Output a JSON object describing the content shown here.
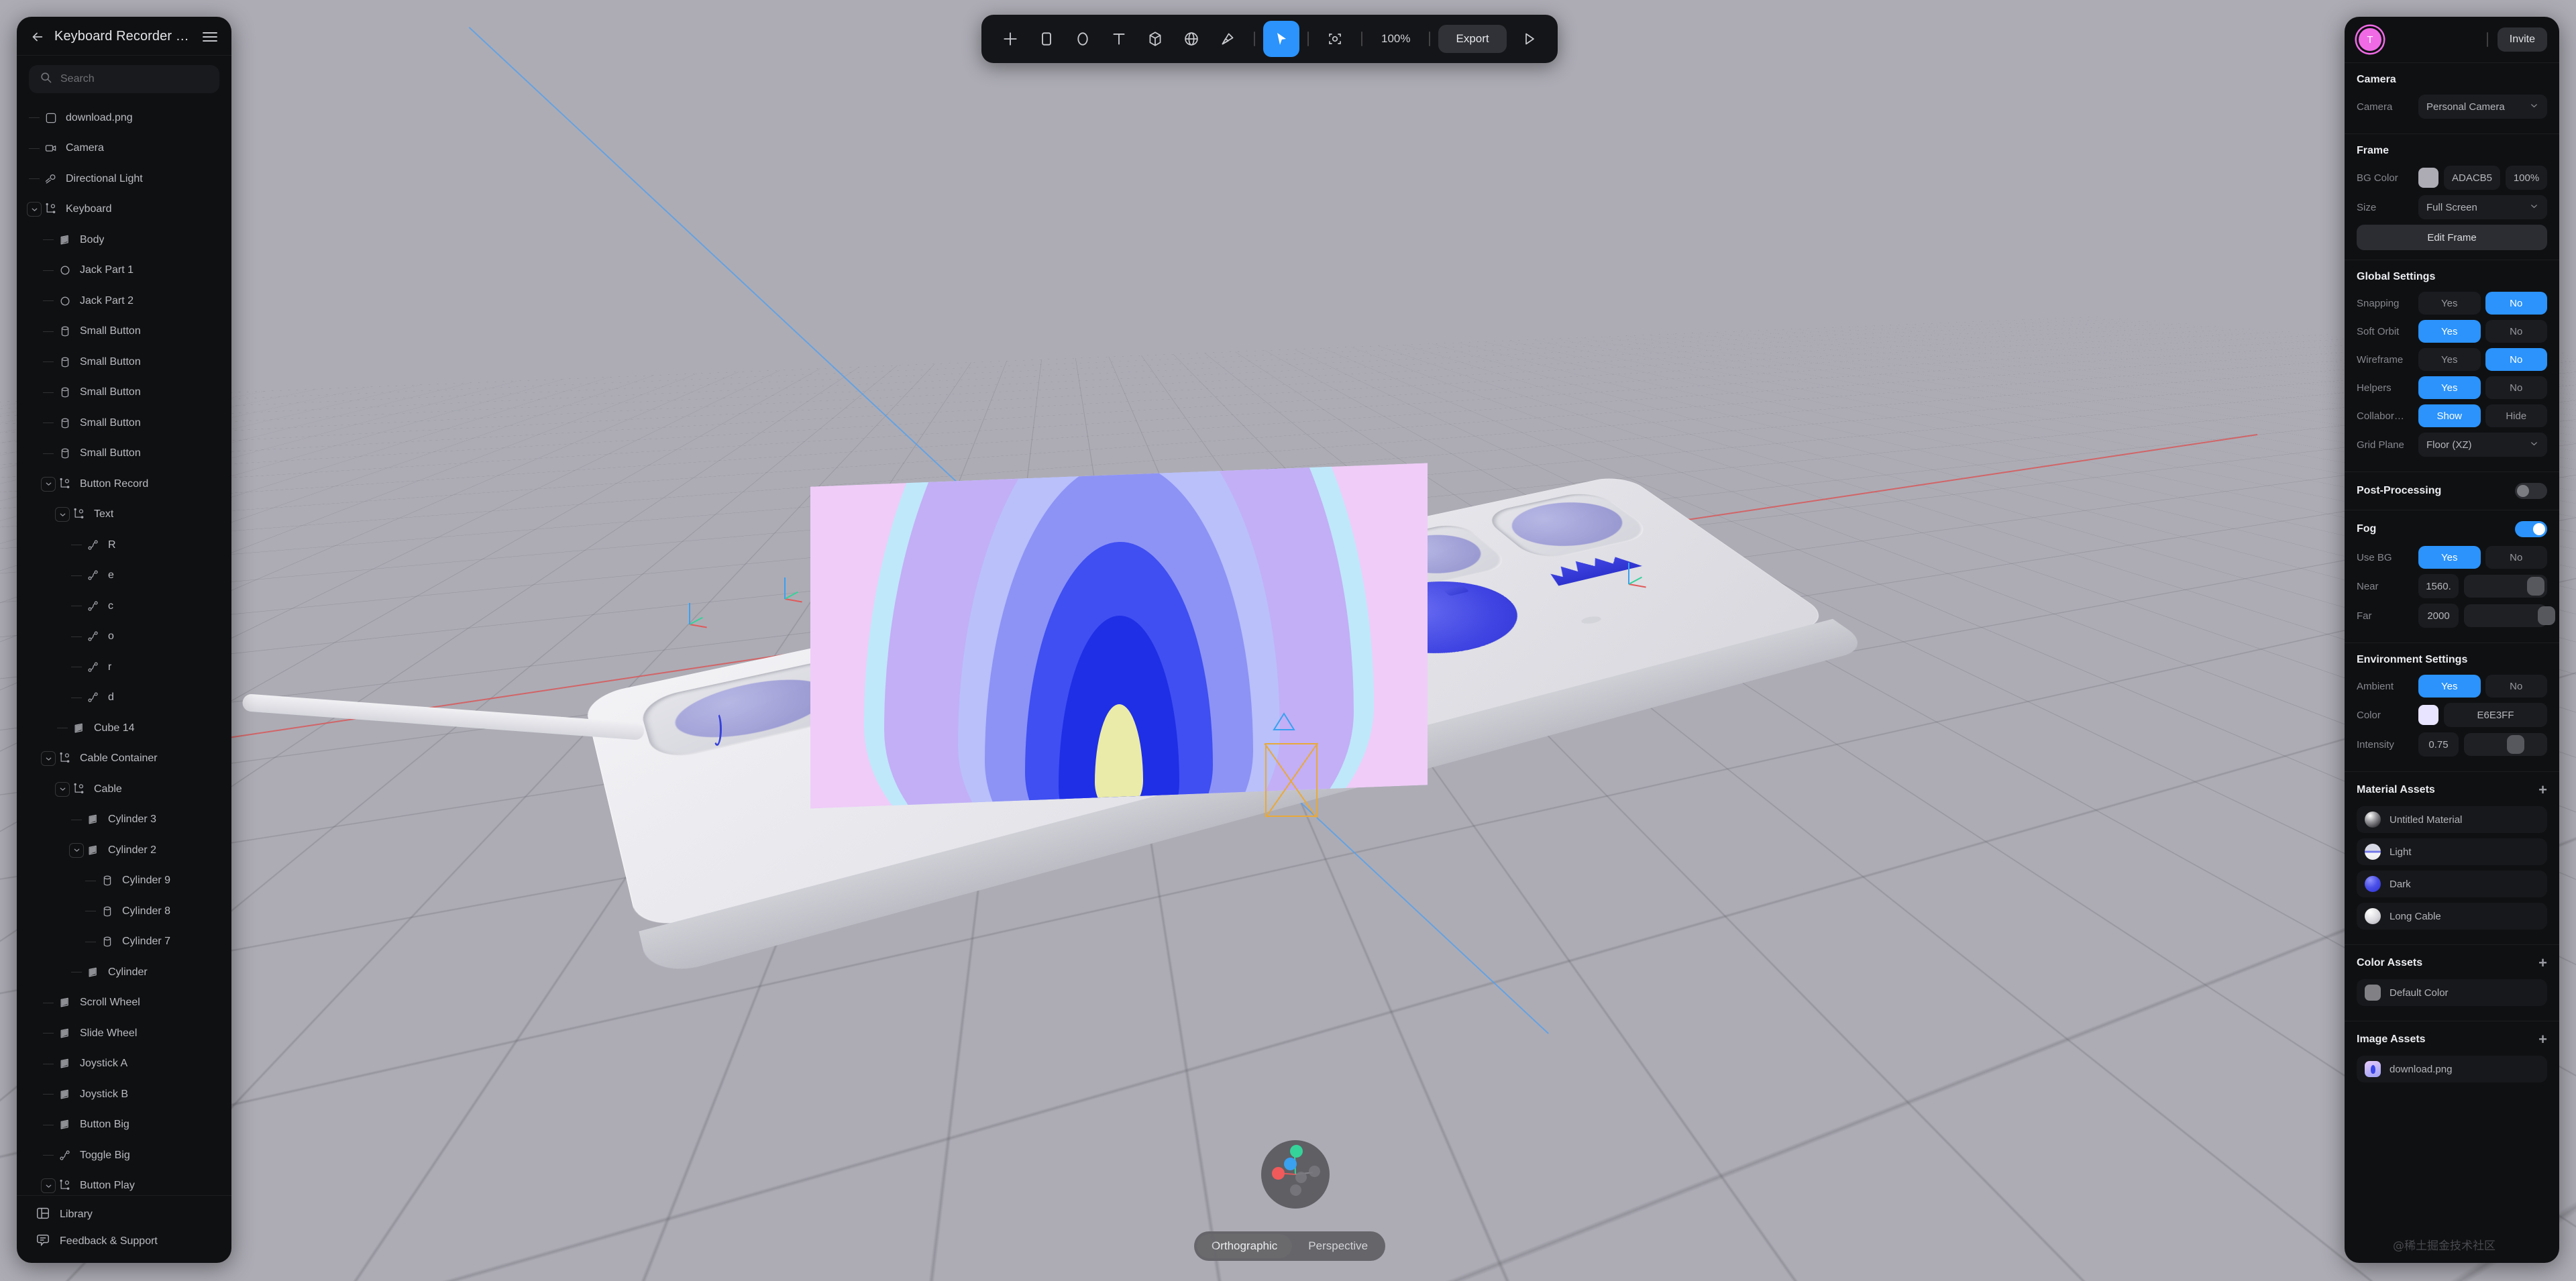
{
  "app": {
    "project_title": "Keyboard Recorder - Copy",
    "back_icon": "arrow-left-icon",
    "menu_icon": "hamburger-menu-icon"
  },
  "search": {
    "placeholder": "Search",
    "value": "",
    "icon": "search-icon"
  },
  "tree": {
    "items": [
      {
        "label": "download.png",
        "depth": 0,
        "icon": "image-icon",
        "expander": "none"
      },
      {
        "label": "Camera",
        "depth": 0,
        "icon": "camera-icon",
        "expander": "none"
      },
      {
        "label": "Directional Light",
        "depth": 0,
        "icon": "light-icon",
        "expander": "none"
      },
      {
        "label": "Keyboard",
        "depth": 0,
        "icon": "group-icon",
        "expander": "open"
      },
      {
        "label": "Body",
        "depth": 1,
        "icon": "mesh-icon",
        "expander": "none"
      },
      {
        "label": "Jack Part 1",
        "depth": 1,
        "icon": "circle-icon",
        "expander": "none"
      },
      {
        "label": "Jack Part 2",
        "depth": 1,
        "icon": "circle-icon",
        "expander": "none"
      },
      {
        "label": "Small Button",
        "depth": 1,
        "icon": "cylinder-icon",
        "expander": "none"
      },
      {
        "label": "Small Button",
        "depth": 1,
        "icon": "cylinder-icon",
        "expander": "none"
      },
      {
        "label": "Small Button",
        "depth": 1,
        "icon": "cylinder-icon",
        "expander": "none"
      },
      {
        "label": "Small Button",
        "depth": 1,
        "icon": "cylinder-icon",
        "expander": "none"
      },
      {
        "label": "Small Button",
        "depth": 1,
        "icon": "cylinder-icon",
        "expander": "none"
      },
      {
        "label": "Button Record",
        "depth": 1,
        "icon": "group-icon",
        "expander": "open"
      },
      {
        "label": "Text",
        "depth": 2,
        "icon": "group-icon",
        "expander": "open"
      },
      {
        "label": "R",
        "depth": 3,
        "icon": "spline-icon",
        "expander": "none"
      },
      {
        "label": "e",
        "depth": 3,
        "icon": "spline-icon",
        "expander": "none"
      },
      {
        "label": "c",
        "depth": 3,
        "icon": "spline-icon",
        "expander": "none"
      },
      {
        "label": "o",
        "depth": 3,
        "icon": "spline-icon",
        "expander": "none"
      },
      {
        "label": "r",
        "depth": 3,
        "icon": "spline-icon",
        "expander": "none"
      },
      {
        "label": "d",
        "depth": 3,
        "icon": "spline-icon",
        "expander": "none"
      },
      {
        "label": "Cube 14",
        "depth": 2,
        "icon": "mesh-icon",
        "expander": "none"
      },
      {
        "label": "Cable Container",
        "depth": 1,
        "icon": "group-icon",
        "expander": "open"
      },
      {
        "label": "Cable",
        "depth": 2,
        "icon": "group-icon",
        "expander": "open"
      },
      {
        "label": "Cylinder 3",
        "depth": 3,
        "icon": "mesh-icon",
        "expander": "none"
      },
      {
        "label": "Cylinder 2",
        "depth": 3,
        "icon": "mesh-icon",
        "expander": "open"
      },
      {
        "label": "Cylinder 9",
        "depth": 4,
        "icon": "cylinder-icon",
        "expander": "none"
      },
      {
        "label": "Cylinder 8",
        "depth": 4,
        "icon": "cylinder-icon",
        "expander": "none"
      },
      {
        "label": "Cylinder 7",
        "depth": 4,
        "icon": "cylinder-icon",
        "expander": "none"
      },
      {
        "label": "Cylinder",
        "depth": 3,
        "icon": "mesh-icon",
        "expander": "none"
      },
      {
        "label": "Scroll Wheel",
        "depth": 1,
        "icon": "mesh-icon",
        "expander": "none"
      },
      {
        "label": "Slide Wheel",
        "depth": 1,
        "icon": "mesh-icon",
        "expander": "none"
      },
      {
        "label": "Joystick A",
        "depth": 1,
        "icon": "mesh-icon",
        "expander": "none"
      },
      {
        "label": "Joystick B",
        "depth": 1,
        "icon": "mesh-icon",
        "expander": "none"
      },
      {
        "label": "Button Big",
        "depth": 1,
        "icon": "mesh-icon",
        "expander": "none"
      },
      {
        "label": "Toggle Big",
        "depth": 1,
        "icon": "spline-icon",
        "expander": "none"
      },
      {
        "label": "Button Play",
        "depth": 1,
        "icon": "group-icon",
        "expander": "open"
      }
    ]
  },
  "left_footer": {
    "library_label": "Library",
    "library_icon": "library-icon",
    "feedback_label": "Feedback & Support",
    "feedback_icon": "chat-icon"
  },
  "toolbar": {
    "tools": [
      {
        "name": "add-icon",
        "label": "+"
      },
      {
        "name": "rectangle-icon",
        "label": ""
      },
      {
        "name": "ellipse-icon",
        "label": ""
      },
      {
        "name": "text-icon",
        "label": "T"
      },
      {
        "name": "cube-icon",
        "label": ""
      },
      {
        "name": "sphere-icon",
        "label": ""
      },
      {
        "name": "pen-icon",
        "label": ""
      }
    ],
    "select_tool": "cursor-icon",
    "frame_tool": "frame-select-icon",
    "zoom_level": "100%",
    "export_label": "Export",
    "play_icon": "play-icon"
  },
  "right": {
    "avatar_initial": "T",
    "invite_label": "Invite",
    "camera": {
      "title": "Camera",
      "camera_label": "Camera",
      "camera_value": "Personal Camera"
    },
    "frame": {
      "title": "Frame",
      "bg_color_label": "BG Color",
      "bg_color_hex": "ADACB5",
      "bg_color_swatch": "#adacb5",
      "bg_color_opacity": "100%",
      "size_label": "Size",
      "size_value": "Full Screen",
      "edit_frame_label": "Edit Frame"
    },
    "global": {
      "title": "Global Settings",
      "rows": [
        {
          "label": "Snapping",
          "yes": "Yes",
          "no": "No",
          "selected": "no"
        },
        {
          "label": "Soft Orbit",
          "yes": "Yes",
          "no": "No",
          "selected": "yes"
        },
        {
          "label": "Wireframe",
          "yes": "Yes",
          "no": "No",
          "selected": "no"
        },
        {
          "label": "Helpers",
          "yes": "Yes",
          "no": "No",
          "selected": "yes"
        },
        {
          "label": "Collabor…",
          "yes": "Show",
          "no": "Hide",
          "selected": "yes"
        }
      ],
      "grid_plane_label": "Grid Plane",
      "grid_plane_value": "Floor (XZ)"
    },
    "post_processing": {
      "title": "Post-Processing",
      "enabled": false
    },
    "fog": {
      "title": "Fog",
      "enabled": true,
      "use_bg_label": "Use BG",
      "use_bg_yes": "Yes",
      "use_bg_no": "No",
      "use_bg_selected": "yes",
      "near_label": "Near",
      "near_value": "1560.",
      "near_pct": 76,
      "far_label": "Far",
      "far_value": "2000",
      "far_pct": 96
    },
    "environment": {
      "title": "Environment Settings",
      "ambient_label": "Ambient",
      "ambient_yes": "Yes",
      "ambient_no": "No",
      "ambient_selected": "yes",
      "color_label": "Color",
      "color_hex": "E6E3FF",
      "color_swatch": "#e8e4ff",
      "intensity_label": "Intensity",
      "intensity_value": "0.75",
      "intensity_pct": 52
    },
    "material_assets": {
      "title": "Material Assets",
      "add_icon": "plus-icon",
      "items": [
        {
          "label": "Untitled Material",
          "ball": "metal"
        },
        {
          "label": "Light",
          "ball": "light"
        },
        {
          "label": "Dark",
          "ball": "dark"
        },
        {
          "label": "Long Cable",
          "ball": "white"
        }
      ]
    },
    "color_assets": {
      "title": "Color Assets",
      "add_icon": "plus-icon",
      "items": [
        {
          "label": "Default Color",
          "swatch": "#808085"
        }
      ]
    },
    "image_assets": {
      "title": "Image Assets",
      "add_icon": "plus-icon",
      "items": [
        {
          "label": "download.png"
        }
      ]
    }
  },
  "viewport": {
    "projection": {
      "orthographic": "Orthographic",
      "perspective": "Perspective",
      "selected": "orthographic"
    },
    "gizmo_name": "view-orientation-gizmo",
    "axis_colors": {
      "x": "#e05a5a",
      "y": "#35d39a",
      "z": "#3aa0f0"
    }
  },
  "watermark": "@稀土掘金技术社区"
}
